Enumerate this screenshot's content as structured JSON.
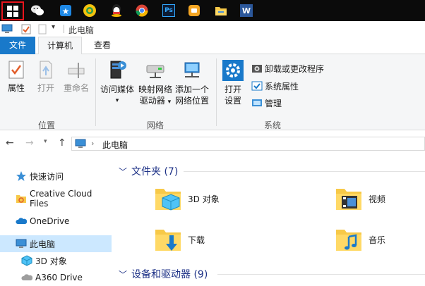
{
  "taskbar": {
    "icons": [
      "windows-start-icon",
      "wechat-icon",
      "baidu-netdisk-icon",
      "qq-browser-icon",
      "qq-icon",
      "chrome-icon",
      "photoshop-icon",
      "orange-app-icon",
      "file-explorer-icon",
      "word-icon"
    ],
    "ps_label": "Ps",
    "word_label": "W"
  },
  "window": {
    "title": "此电脑"
  },
  "tabs": {
    "file": "文件",
    "computer": "计算机",
    "view": "查看"
  },
  "ribbon": {
    "location_group": {
      "label": "位置",
      "properties": "属性",
      "open": "打开",
      "rename": "重命名"
    },
    "network_group": {
      "label": "网络",
      "access_media_line1": "访问媒体",
      "map_drive_line1": "映射网络",
      "map_drive_line2": "驱动器",
      "add_location_line1": "添加一个",
      "add_location_line2": "网络位置"
    },
    "system_group": {
      "label": "系统",
      "open_settings_line1": "打开",
      "open_settings_line2": "设置",
      "uninstall": "卸载或更改程序",
      "system_properties": "系统属性",
      "manage": "管理"
    }
  },
  "address": {
    "path": "此电脑"
  },
  "nav": {
    "items": [
      {
        "label": "快速访问",
        "icon": "star-icon"
      },
      {
        "label": "Creative Cloud Files",
        "icon": "creative-cloud-folder-icon"
      },
      {
        "label": "OneDrive",
        "icon": "onedrive-cloud-icon"
      },
      {
        "label": "此电脑",
        "icon": "computer-icon"
      },
      {
        "label": "3D 对象",
        "icon": "3d-objects-icon"
      },
      {
        "label": "A360 Drive",
        "icon": "a360-drive-icon"
      }
    ]
  },
  "content": {
    "folders_header": "文件夹 (7)",
    "devices_header": "设备和驱动器 (9)",
    "folders": [
      {
        "label": "3D 对象",
        "icon": "3d-objects-folder-icon"
      },
      {
        "label": "视频",
        "icon": "videos-folder-icon"
      },
      {
        "label": "下载",
        "icon": "downloads-folder-icon"
      },
      {
        "label": "音乐",
        "icon": "music-folder-icon"
      }
    ]
  },
  "colors": {
    "accent": "#1979ca",
    "selected_nav": "#cce8ff",
    "section_header": "#1e3287",
    "start_highlight": "#e8141c"
  }
}
